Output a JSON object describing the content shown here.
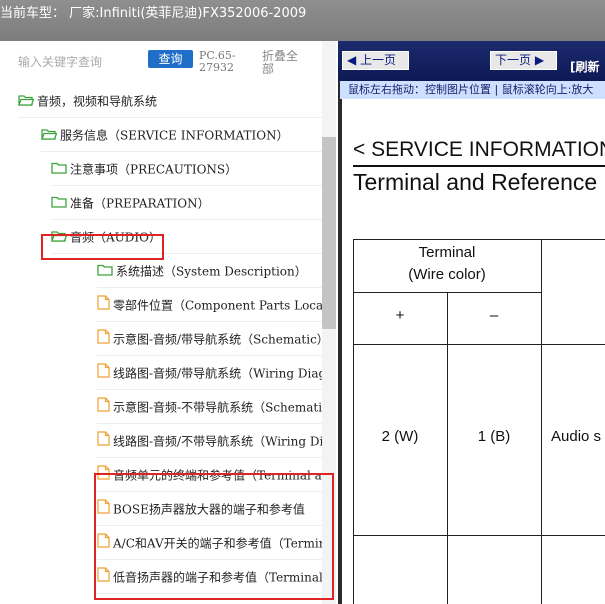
{
  "window": {
    "title": "当前车型： 厂家:Infiniti(英菲尼迪)FX352006-2009"
  },
  "search": {
    "placeholder": "输入关键字查询",
    "query_label": "查询",
    "count_text": "PC.65-27932",
    "collapse_label": "折叠全部"
  },
  "tree": {
    "items": [
      {
        "label": "音频，视频和导航系统",
        "icon": "folder-open-icon"
      },
      {
        "label": "服务信息（SERVICE INFORMATION）",
        "icon": "folder-open-icon"
      },
      {
        "label": "注意事项（PRECAUTIONS）",
        "icon": "folder-icon"
      },
      {
        "label": "准备（PREPARATION）",
        "icon": "folder-icon"
      },
      {
        "label": "音频（AUDIO）",
        "icon": "folder-open-icon"
      },
      {
        "label": "系统描述（System Description）",
        "icon": "folder-icon"
      },
      {
        "label": "零部件位置（Component Parts Location）",
        "icon": "page-icon"
      },
      {
        "label": "示意图-音频/带导航系统（Schematic）",
        "icon": "page-icon"
      },
      {
        "label": "线路图-音频/带导航系统（Wiring Diagram）",
        "icon": "page-icon"
      },
      {
        "label": "示意图-音频-不带导航系统（Schematic）",
        "icon": "page-icon"
      },
      {
        "label": "线路图-音频/不带导航系统（Wiring Diagram）",
        "icon": "page-icon"
      },
      {
        "label": "音频单元的终端和参考值（Terminal and Reference）",
        "icon": "page-icon"
      },
      {
        "label": "BOSE扬声器放大器的端子和参考值",
        "icon": "page-icon"
      },
      {
        "label": "A/C和AV开关的端子和参考值（Terminal）",
        "icon": "page-icon"
      },
      {
        "label": "低音扬声器的端子和参考值（Terminal）",
        "icon": "page-icon"
      }
    ]
  },
  "viewer": {
    "prev_label": "上一页",
    "next_label": "下一页",
    "refresh_label": "[刷新",
    "hint_text": "鼠标左右拖动：控制图片位置 | 鼠标滚轮向上:放大",
    "section_title": "< SERVICE INFORMATION",
    "heading": "Terminal and Reference",
    "table": {
      "header_terminal": "Terminal",
      "header_wire_color": "(Wire color)",
      "plus": "+",
      "minus": "–",
      "row_plus": "2 (W)",
      "row_minus": "1 (B)",
      "row_desc": "Audio s"
    }
  },
  "colors": {
    "titlebar": "#888888",
    "accent_blue": "#1f6fc9",
    "nav_dark_blue": "#0e1a55",
    "highlight_red": "#e02424",
    "folder_green": "#3ca33c",
    "page_orange": "#f0a030"
  }
}
